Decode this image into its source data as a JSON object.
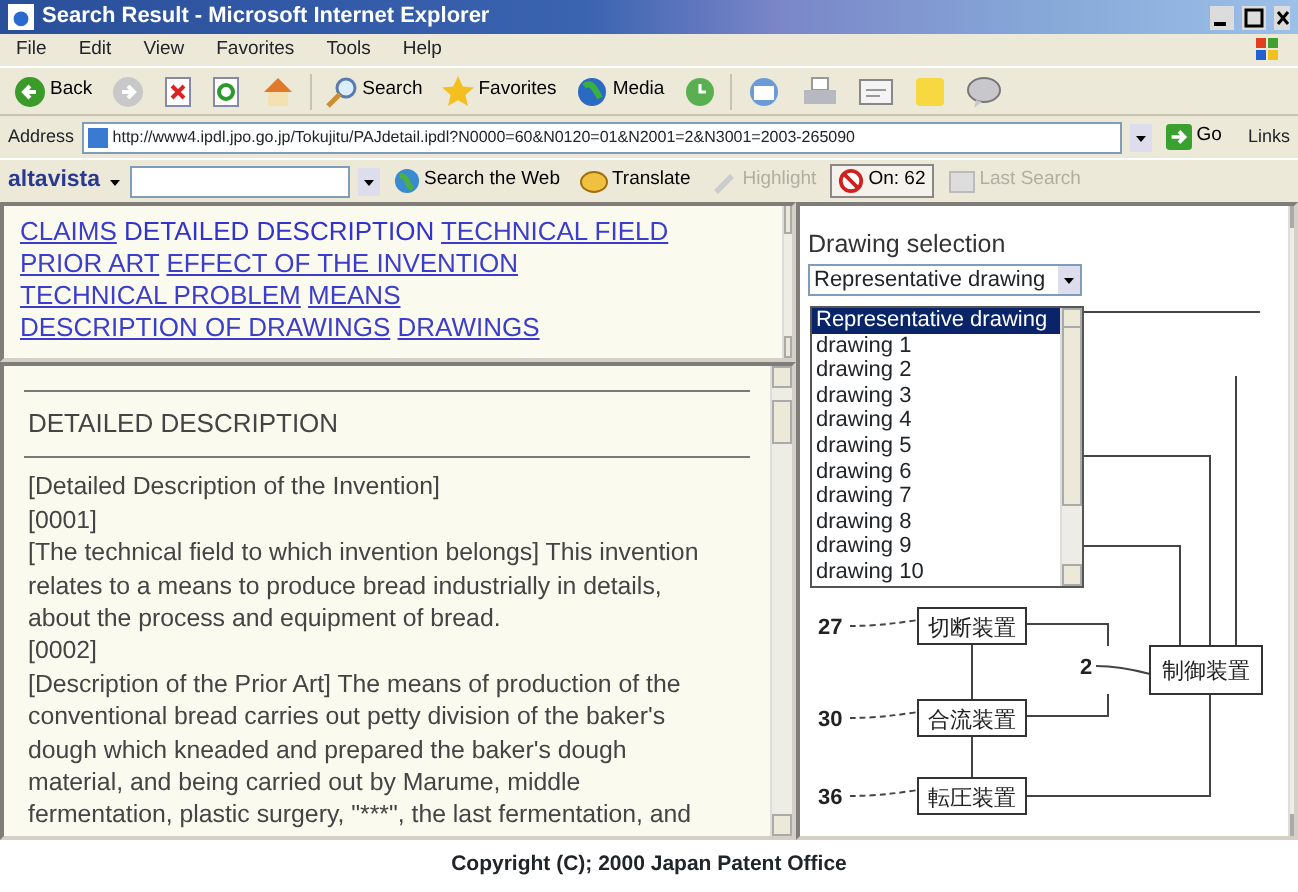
{
  "window": {
    "title": "Search Result - Microsoft Internet Explorer"
  },
  "menu": [
    "File",
    "Edit",
    "View",
    "Favorites",
    "Tools",
    "Help"
  ],
  "toolbar": [
    {
      "kind": "back",
      "label": "Back"
    },
    {
      "kind": "forward"
    },
    {
      "kind": "stop"
    },
    {
      "kind": "refresh"
    },
    {
      "kind": "home"
    },
    {
      "kind": "search",
      "label": "Search"
    },
    {
      "kind": "favorites",
      "label": "Favorites"
    },
    {
      "kind": "media",
      "label": "Media"
    },
    {
      "kind": "history"
    },
    {
      "kind": "mail"
    },
    {
      "kind": "print"
    },
    {
      "kind": "edit"
    },
    {
      "kind": "note"
    },
    {
      "kind": "messenger"
    }
  ],
  "address": {
    "label": "Address",
    "url": "http://www4.ipdl.jpo.go.jp/Tokujitu/PAJdetail.ipdl?N0000=60&N0120=01&N2001=2&N3001=2003-265090",
    "go": "Go",
    "links": "Links"
  },
  "altavista": {
    "brand": "altavista",
    "items": [
      {
        "kind": "globe",
        "label": "Search the Web",
        "disabled": false
      },
      {
        "kind": "translate",
        "label": "Translate",
        "disabled": false
      },
      {
        "kind": "highlight",
        "label": "Highlight",
        "disabled": true
      },
      {
        "kind": "blocker",
        "label": "On: 62",
        "disabled": false
      },
      {
        "kind": "last",
        "label": "Last Search",
        "disabled": true
      }
    ]
  },
  "nav": [
    {
      "text": "CLAIMS",
      "link": true
    },
    {
      "text": "DETAILED DESCRIPTION",
      "link": false
    },
    {
      "text": "TECHNICAL FIELD",
      "link": true
    },
    {
      "text": "PRIOR ART",
      "link": true
    },
    {
      "text": "EFFECT OF THE INVENTION",
      "link": true
    },
    {
      "text": "TECHNICAL PROBLEM",
      "link": true
    },
    {
      "text": "MEANS",
      "link": true
    },
    {
      "text": "DESCRIPTION OF DRAWINGS",
      "link": true
    },
    {
      "text": "DRAWINGS",
      "link": true
    }
  ],
  "description": {
    "heading": "DETAILED DESCRIPTION",
    "paragraphs": [
      {
        "lines": [
          "[Detailed Description of the Invention]"
        ]
      },
      {
        "lines": [
          "[0001]"
        ]
      },
      {
        "lines": [
          "[The technical field to which invention belongs] This invention",
          "relates to a means to produce bread industrially in details,",
          "about the process and equipment of bread."
        ]
      },
      {
        "lines": [
          "[0002]"
        ]
      },
      {
        "lines": [
          "[Description of the Prior Art] The means of production of the",
          "conventional bread carries out petty division of the baker's",
          "dough which kneaded and prepared the baker's dough",
          "material, and being carried out by Marume, middle",
          "fermentation, plastic surgery, \"***\", the last fermentation, and"
        ]
      }
    ]
  },
  "drawing": {
    "label": "Drawing selection",
    "value": "Representative drawing",
    "options": [
      {
        "text": "Representative drawing",
        "selected": true
      },
      {
        "text": "drawing 1",
        "selected": false
      },
      {
        "text": "drawing 2",
        "selected": false
      },
      {
        "text": "drawing 3",
        "selected": false
      },
      {
        "text": "drawing 4",
        "selected": false
      },
      {
        "text": "drawing 5",
        "selected": false
      },
      {
        "text": "drawing 6",
        "selected": false
      },
      {
        "text": "drawing 7",
        "selected": false
      },
      {
        "text": "drawing 8",
        "selected": false
      },
      {
        "text": "drawing 9",
        "selected": false
      },
      {
        "text": "drawing 10",
        "selected": false
      }
    ],
    "blocks": [
      {
        "number": "27",
        "label": "切断装置"
      },
      {
        "number": "30",
        "label": "合流装置"
      },
      {
        "number": "36",
        "label": "転圧装置"
      }
    ],
    "controller": {
      "number": "2",
      "label": "制御装置"
    }
  },
  "footer": "Copyright (C); 2000 Japan Patent Office"
}
